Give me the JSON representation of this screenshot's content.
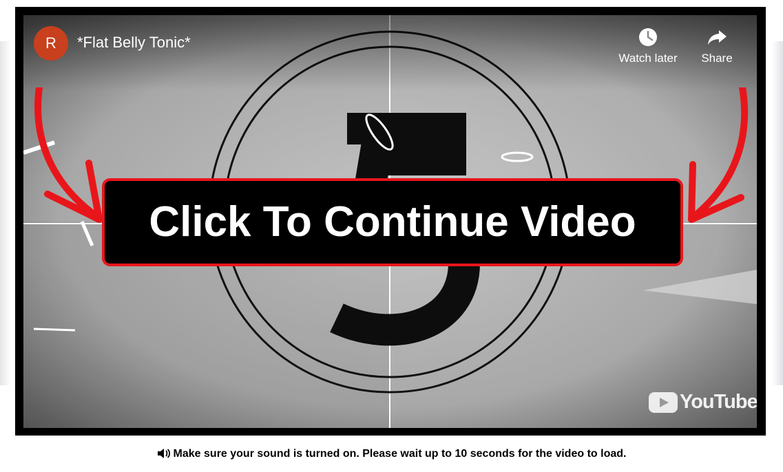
{
  "video": {
    "channel_initial": "R",
    "title": "*Flat Belly Tonic*",
    "countdown_number": "5",
    "watch_later_label": "Watch later",
    "share_label": "Share",
    "cta_label": "Click To Continue Video",
    "youtube_logo_text": "YouTube"
  },
  "notice": {
    "text": "Make sure your sound is turned on. Please wait up to 10 seconds for the video to load."
  },
  "icons": {
    "clock": "clock-icon",
    "share": "share-arrow-icon",
    "speaker": "speaker-icon",
    "red_arrow": "red-arrow-icon",
    "youtube_play": "youtube-play-icon"
  },
  "colors": {
    "accent_red": "#e8161b",
    "avatar": "#c8401e",
    "frame": "#000000"
  }
}
